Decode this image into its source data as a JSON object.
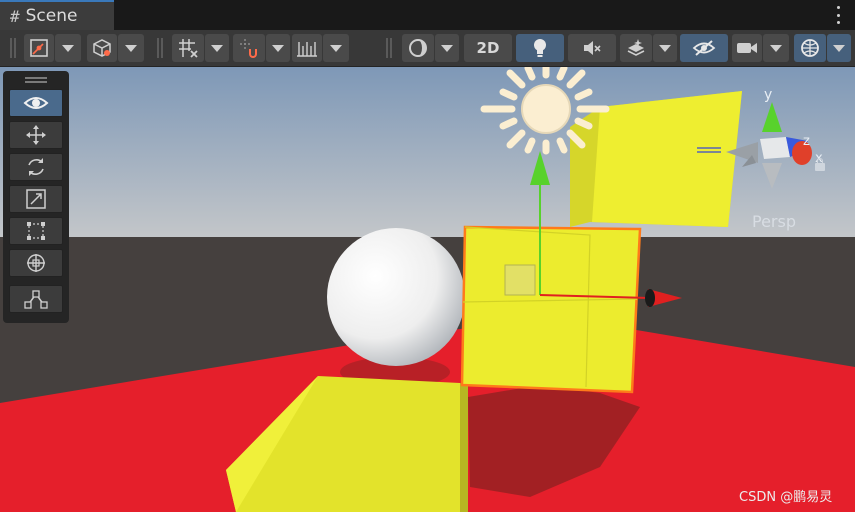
{
  "tab": {
    "title": "Scene"
  },
  "toolbar": {
    "mode_2d_label": "2D"
  },
  "tools": [
    {
      "name": "view-tool"
    },
    {
      "name": "move-tool"
    },
    {
      "name": "rotate-tool"
    },
    {
      "name": "scale-tool"
    },
    {
      "name": "rect-tool"
    },
    {
      "name": "transform-tool"
    },
    {
      "name": "custom-editor-tool"
    }
  ],
  "orientation_gizmo": {
    "projection_label": "Persp",
    "axis_y": "y",
    "axis_z": "z",
    "axis_x": "x"
  },
  "watermark": "CSDN @鹏易灵",
  "colors": {
    "floor": "#e51f2b",
    "cube_yellow": "#e8e82a",
    "selection_outline": "#ff7a1a",
    "axis_x": "#e02020",
    "axis_y": "#58d22c",
    "active_tool": "#4a6a8c"
  }
}
